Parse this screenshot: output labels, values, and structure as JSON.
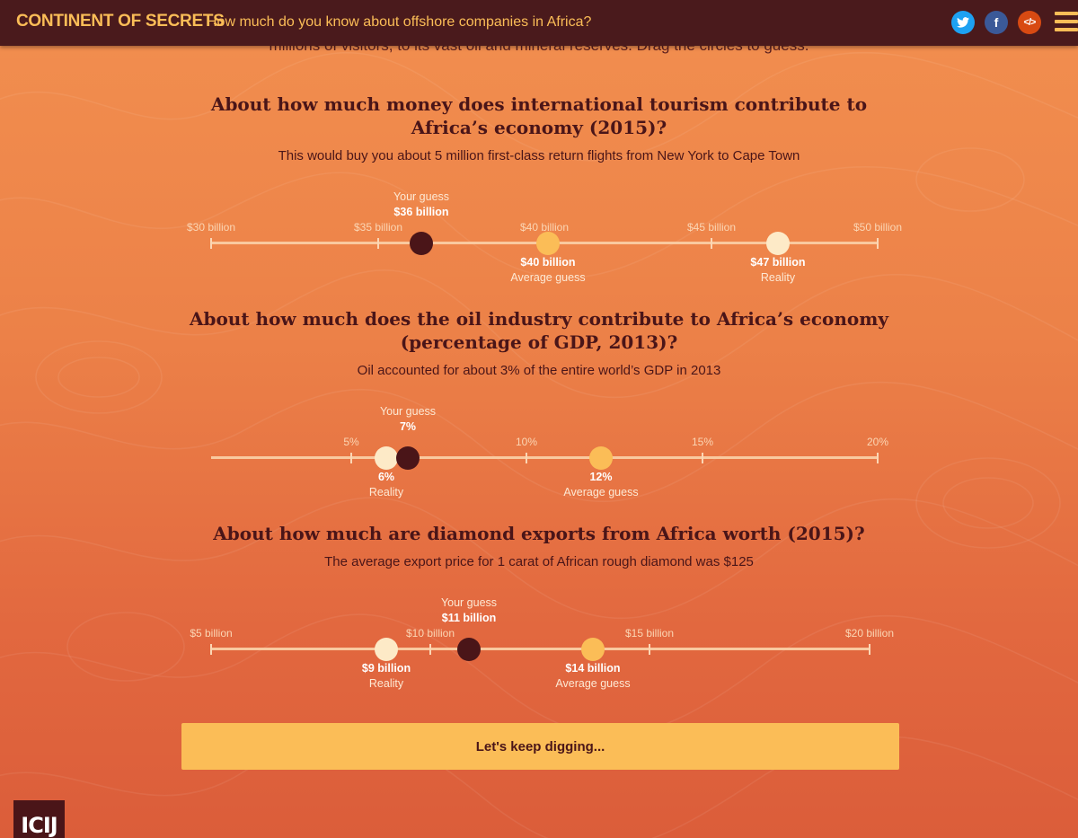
{
  "header": {
    "brand": "CONTINENT OF SECRETS",
    "tagline": "How much do you know about offshore companies in Africa?",
    "icons": [
      "twitter-icon",
      "facebook-icon",
      "embed-icon",
      "menu-icon"
    ]
  },
  "intro": "millions of visitors, to its vast oil and mineral reserves. Drag the circles to guess.",
  "questions": [
    {
      "title": "About how much money does international tourism contribute to Africa’s economy (2015)?",
      "subtitle": "This would buy you about 5 million first-class return flights from New York to Cape Town",
      "ticks": [
        "$30 billion",
        "$35 billion",
        "$40 billion",
        "$45 billion",
        "$50 billion"
      ],
      "guess": {
        "label": "Your guess",
        "value": "$36 billion",
        "num": 36
      },
      "average": {
        "label": "Average guess",
        "value": "$40 billion",
        "num": 40
      },
      "reality": {
        "label": "Reality",
        "value": "$47 billion",
        "num": 47
      }
    },
    {
      "title": "About how much does the oil industry contribute to Africa’s economy (percentage of GDP, 2013)?",
      "subtitle": "Oil accounted for about 3% of the entire world’s GDP in 2013",
      "ticks": [
        "",
        "5%",
        "10%",
        "15%",
        "20%"
      ],
      "guess": {
        "label": "Your guess",
        "value": "7%",
        "num": 7
      },
      "average": {
        "label": "Average guess",
        "value": "12%",
        "num": 12
      },
      "reality": {
        "label": "Reality",
        "value": "6%",
        "num": 6
      }
    },
    {
      "title": "About how much are diamond exports from Africa worth (2015)?",
      "subtitle": "The average export price for 1 carat of African rough diamond was $125",
      "ticks": [
        "$5 billion",
        "$10 billion",
        "$15 billion",
        "$20 billion"
      ],
      "guess": {
        "label": "Your guess",
        "value": "$11 billion",
        "num": 11
      },
      "average": {
        "label": "Average guess",
        "value": "$14 billion",
        "num": 14
      },
      "reality": {
        "label": "Reality",
        "value": "$9 billion",
        "num": 9
      }
    }
  ],
  "cta": "Let's keep digging...",
  "footer": {
    "logo": "ICIJ"
  },
  "colors": {
    "header_bg": "#4a1a1c",
    "accent": "#fbbd57",
    "guess_dot": "#4a1518",
    "reality_dot": "#fdeac7"
  }
}
